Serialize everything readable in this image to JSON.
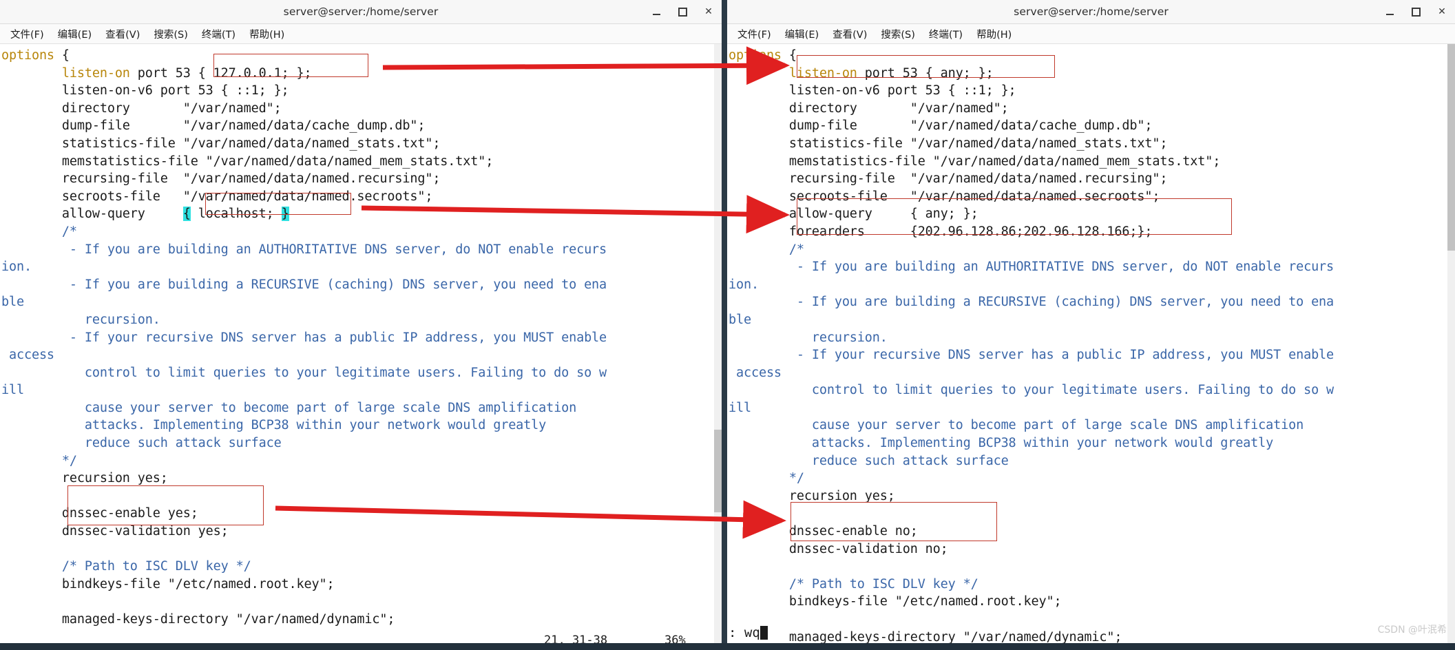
{
  "window": {
    "title": "server@server:/home/server",
    "buttons": {
      "minimize": "minimize-button",
      "maximize": "maximize-button",
      "close": "✕"
    },
    "menu": [
      "文件(F)",
      "编辑(E)",
      "查看(V)",
      "搜索(S)",
      "终端(T)",
      "帮助(H)"
    ]
  },
  "colors": {
    "keyword": "#b8860b",
    "comment": "#3a66a8",
    "annotation": "#c0392b",
    "brace_highlight": "#2fe0e0",
    "background": "#ffffff",
    "text": "#1b1b1b",
    "divider": "#2b3a46"
  },
  "left_pane": {
    "lines": [
      {
        "t": "options {",
        "k": "options"
      },
      {
        "t": "        listen-on port 53 { 127.0.0.1; };",
        "k": "listen-on"
      },
      {
        "t": "        listen-on-v6 port 53 { ::1; };"
      },
      {
        "t": "        directory       \"/var/named\";"
      },
      {
        "t": "        dump-file       \"/var/named/data/cache_dump.db\";"
      },
      {
        "t": "        statistics-file \"/var/named/data/named_stats.txt\";"
      },
      {
        "t": "        memstatistics-file \"/var/named/data/named_mem_stats.txt\";"
      },
      {
        "t": "        recursing-file  \"/var/named/data/named.recursing\";"
      },
      {
        "t": "        secroots-file   \"/var/named/data/named.secroots\";"
      },
      {
        "t": "        allow-query     { localhost; }",
        "brace": true
      },
      {
        "t": "        /*",
        "c": true
      },
      {
        "t": "         - If you are building an AUTHORITATIVE DNS server, do NOT enable recurs",
        "c": true
      },
      {
        "t": "ion.",
        "c": true
      },
      {
        "t": "         - If you are building a RECURSIVE (caching) DNS server, you need to ena",
        "c": true
      },
      {
        "t": "ble",
        "c": true
      },
      {
        "t": "           recursion.",
        "c": true
      },
      {
        "t": "         - If your recursive DNS server has a public IP address, you MUST enable",
        "c": true
      },
      {
        "t": " access",
        "c": true
      },
      {
        "t": "           control to limit queries to your legitimate users. Failing to do so w",
        "c": true
      },
      {
        "t": "ill",
        "c": true
      },
      {
        "t": "           cause your server to become part of large scale DNS amplification",
        "c": true
      },
      {
        "t": "           attacks. Implementing BCP38 within your network would greatly",
        "c": true
      },
      {
        "t": "           reduce such attack surface",
        "c": true
      },
      {
        "t": "        */",
        "c": true
      },
      {
        "t": "        recursion yes;"
      },
      {
        "t": ""
      },
      {
        "t": "        dnssec-enable yes;"
      },
      {
        "t": "        dnssec-validation yes;"
      },
      {
        "t": ""
      },
      {
        "t": "        /* Path to ISC DLV key */",
        "c": true
      },
      {
        "t": "        bindkeys-file \"/etc/named.root.key\";"
      },
      {
        "t": ""
      },
      {
        "t": "        managed-keys-directory \"/var/named/dynamic\";"
      }
    ],
    "status": {
      "position": "21, 31-38",
      "percent": "36%"
    }
  },
  "right_pane": {
    "lines": [
      {
        "t": "options {",
        "k": "options"
      },
      {
        "t": "        listen-on port 53 { any; };",
        "k": "listen-on"
      },
      {
        "t": "        listen-on-v6 port 53 { ::1; };"
      },
      {
        "t": "        directory       \"/var/named\";"
      },
      {
        "t": "        dump-file       \"/var/named/data/cache_dump.db\";"
      },
      {
        "t": "        statistics-file \"/var/named/data/named_stats.txt\";"
      },
      {
        "t": "        memstatistics-file \"/var/named/data/named_mem_stats.txt\";"
      },
      {
        "t": "        recursing-file  \"/var/named/data/named.recursing\";"
      },
      {
        "t": "        secroots-file   \"/var/named/data/named.secroots\";"
      },
      {
        "t": "        allow-query     { any; };"
      },
      {
        "t": "        forearders      {202.96.128.86;202.96.128.166;};"
      },
      {
        "t": "        /*",
        "c": true
      },
      {
        "t": "         - If you are building an AUTHORITATIVE DNS server, do NOT enable recurs",
        "c": true
      },
      {
        "t": "ion.",
        "c": true
      },
      {
        "t": "         - If you are building a RECURSIVE (caching) DNS server, you need to ena",
        "c": true
      },
      {
        "t": "ble",
        "c": true
      },
      {
        "t": "           recursion.",
        "c": true
      },
      {
        "t": "         - If your recursive DNS server has a public IP address, you MUST enable",
        "c": true
      },
      {
        "t": " access",
        "c": true
      },
      {
        "t": "           control to limit queries to your legitimate users. Failing to do so w",
        "c": true
      },
      {
        "t": "ill",
        "c": true
      },
      {
        "t": "           cause your server to become part of large scale DNS amplification",
        "c": true
      },
      {
        "t": "           attacks. Implementing BCP38 within your network would greatly",
        "c": true
      },
      {
        "t": "           reduce such attack surface",
        "c": true
      },
      {
        "t": "        */",
        "c": true
      },
      {
        "t": "        recursion yes;"
      },
      {
        "t": ""
      },
      {
        "t": "        dnssec-enable no;"
      },
      {
        "t": "        dnssec-validation no;"
      },
      {
        "t": ""
      },
      {
        "t": "        /* Path to ISC DLV key */",
        "c": true
      },
      {
        "t": "        bindkeys-file \"/etc/named.root.key\";"
      },
      {
        "t": ""
      },
      {
        "t": "        managed-keys-directory \"/var/named/dynamic\";"
      }
    ],
    "command": ": wq"
  },
  "watermark": "CSDN @叶泯希"
}
